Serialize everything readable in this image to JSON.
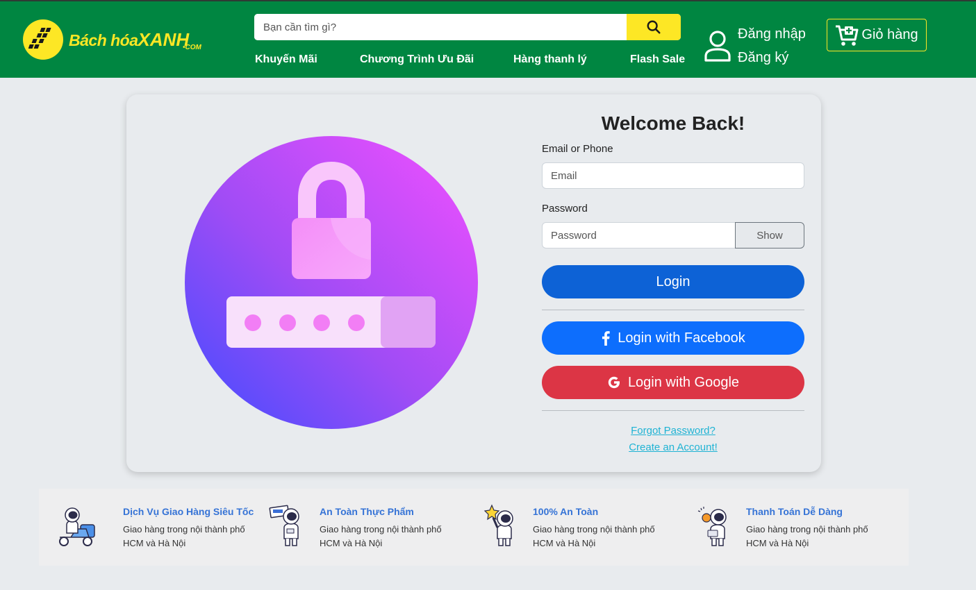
{
  "brand": {
    "name_part1": "Bách hóa",
    "name_part2": "XANH",
    "suffix": "•COM",
    "color": "#fde725",
    "header_bg": "#008641"
  },
  "search": {
    "placeholder": "Bạn cần tìm gì?",
    "icon": "search-icon"
  },
  "nav": [
    "Khuyến Mãi",
    "Chương Trình Ưu Đãi",
    "Hàng thanh lý",
    "Flash Sale"
  ],
  "account": {
    "login": "Đăng nhập",
    "register": "Đăng ký",
    "icon": "user-icon"
  },
  "cart": {
    "label": "Giỏ hàng",
    "icon": "cart-icon"
  },
  "login_form": {
    "title": "Welcome Back!",
    "email_label": "Email or Phone",
    "email_placeholder": "Email",
    "password_label": "Password",
    "password_placeholder": "Password",
    "show_label": "Show",
    "login_label": "Login",
    "facebook_label": "Login with Facebook",
    "google_label": "Login with Google",
    "forgot_label": "Forgot Password?",
    "create_label": "Create an Account!",
    "colors": {
      "login": "#0d62d6",
      "facebook": "#0d6efd",
      "google": "#dc3545",
      "link": "#1fb3d4"
    }
  },
  "features": [
    {
      "title": "Dịch Vụ Giao Hàng Siêu Tốc",
      "desc": "Giao hàng trong nội thành phố HCM và Hà Nội",
      "icon": "astronaut-scooter-icon"
    },
    {
      "title": "An Toàn Thực Phẩm",
      "desc": "Giao hàng trong nội thành phố HCM và Hà Nội",
      "icon": "astronaut-sign-icon"
    },
    {
      "title": "100% An Toàn",
      "desc": "Giao hàng trong nội thành phố HCM và Hà Nội",
      "icon": "astronaut-star-icon"
    },
    {
      "title": "Thanh Toán Dễ Dàng",
      "desc": "Giao hàng trong nội thành phố HCM và Hà Nội",
      "icon": "astronaut-coin-icon"
    }
  ]
}
